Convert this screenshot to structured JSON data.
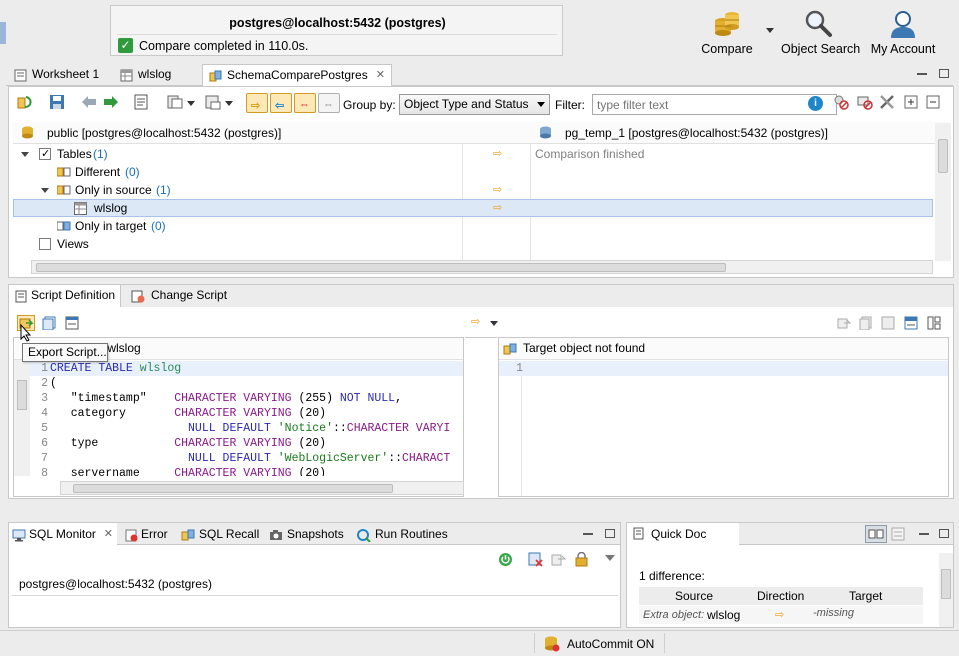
{
  "connection": {
    "title": "postgres@localhost:5432 (postgres)",
    "status": "Compare completed in 110.0s."
  },
  "top_toolbar": {
    "compare_label": "Compare",
    "object_search_label": "Object Search",
    "my_account_label": "My Account"
  },
  "editor_tabs": [
    {
      "label": "Worksheet 1",
      "icon": "worksheet-icon"
    },
    {
      "label": "wlslog",
      "icon": "table-icon"
    },
    {
      "label": "SchemaComparePostgres",
      "icon": "schema-compare-icon",
      "active": true
    }
  ],
  "compare_toolbar": {
    "group_by_label": "Group by:",
    "group_by_value": "Object Type and Status",
    "filter_label": "Filter:",
    "filter_placeholder": "type filter text"
  },
  "tree": {
    "source_header": "public [postgres@localhost:5432 (postgres)]",
    "target_header": "pg_temp_1 [postgres@localhost:5432 (postgres)]",
    "rows": [
      {
        "label": "Tables",
        "count": "(1)",
        "target_text": "Comparison finished"
      },
      {
        "label": "Different",
        "count": "(0)"
      },
      {
        "label": "Only in source",
        "count": "(1)"
      },
      {
        "label": "wlslog"
      },
      {
        "label": "Only in target",
        "count": "(0)"
      },
      {
        "label": "Views"
      }
    ]
  },
  "script_panel": {
    "tab_script_definition": "Script Definition",
    "tab_change_script": "Change Script",
    "left_title": ".wlslog",
    "right_title": "Target object not found",
    "tooltip": "Export Script..."
  },
  "code_left": [
    {
      "n": "1",
      "text": "CREATE TABLE wlslog"
    },
    {
      "n": "2",
      "text": "("
    },
    {
      "n": "3",
      "text": "   \"timestamp\"    CHARACTER VARYING (255) NOT NULL,"
    },
    {
      "n": "4",
      "text": "   category       CHARACTER VARYING (20)"
    },
    {
      "n": "5",
      "text": "                    NULL DEFAULT 'Notice'::CHARACTER VARYI"
    },
    {
      "n": "6",
      "text": "   type           CHARACTER VARYING (20)"
    },
    {
      "n": "7",
      "text": "                    NULL DEFAULT 'WebLogicServer'::CHARACT"
    },
    {
      "n": "8",
      "text": "   servername     CHARACTER VARYING (20)"
    }
  ],
  "code_right": [
    {
      "n": "1",
      "text": ""
    }
  ],
  "bottom_tabs": [
    {
      "label": "SQL Monitor",
      "active": true
    },
    {
      "label": "Error"
    },
    {
      "label": "SQL Recall"
    },
    {
      "label": "Snapshots"
    },
    {
      "label": "Run Routines"
    }
  ],
  "sql_monitor": {
    "connection": "postgres@localhost:5432 (postgres)"
  },
  "quick_doc": {
    "title": "Quick Doc",
    "summary": "1 difference:",
    "headers": [
      "Source",
      "Direction",
      "Target"
    ],
    "row": {
      "prefix": "Extra object:",
      "name": "wlslog",
      "target": "-missing"
    }
  },
  "status_bar": {
    "autocommit": "AutoCommit ON"
  },
  "colors": {
    "accent_orange": "#f0a020",
    "link_blue": "#1a6fb5",
    "selection": "#dde8f6"
  }
}
